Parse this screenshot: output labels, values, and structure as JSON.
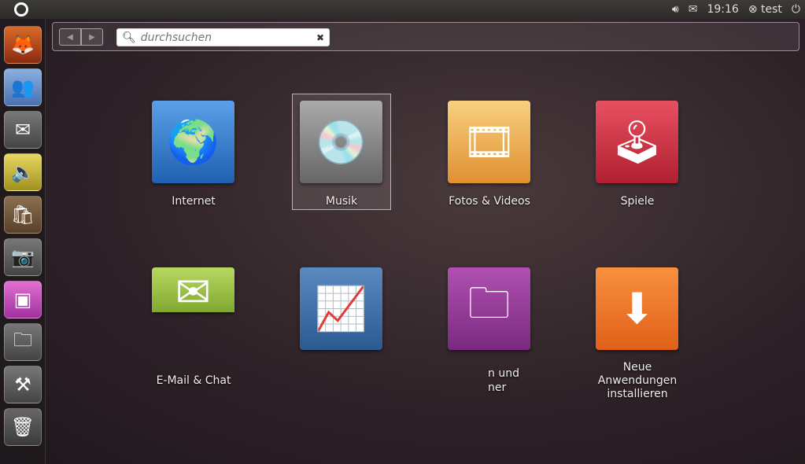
{
  "topbar": {
    "time": "19:16",
    "user": "test",
    "icons": [
      "ubuntu-logo",
      "volume-icon",
      "mail-icon",
      "user-icon",
      "power-icon"
    ]
  },
  "launcher": [
    "firefox",
    "empathy",
    "evolution",
    "rhythmbox",
    "software-center",
    "shotwell",
    "workspace-switcher",
    "files",
    "system-settings",
    "trash"
  ],
  "search": {
    "placeholder": "durchsuchen",
    "back": "◀",
    "forward": "▶",
    "clear": "✖"
  },
  "apps": [
    {
      "label": "Internet",
      "color": "#3a7fd0"
    },
    {
      "label": "Musik",
      "color": "#8a8a8a"
    },
    {
      "label": "Fotos & Videos",
      "color": "#f0b050"
    },
    {
      "label": "Spiele",
      "color": "#d03040"
    },
    {
      "label": "E-Mail & Chat",
      "color": "#9ac040"
    },
    {
      "label": "",
      "color": "#3a6aa0"
    },
    {
      "label1": "n und",
      "label2": "ner",
      "color": "#9a40a0"
    },
    {
      "label": "Neue Anwendungen installieren",
      "color": "#f07020"
    }
  ]
}
